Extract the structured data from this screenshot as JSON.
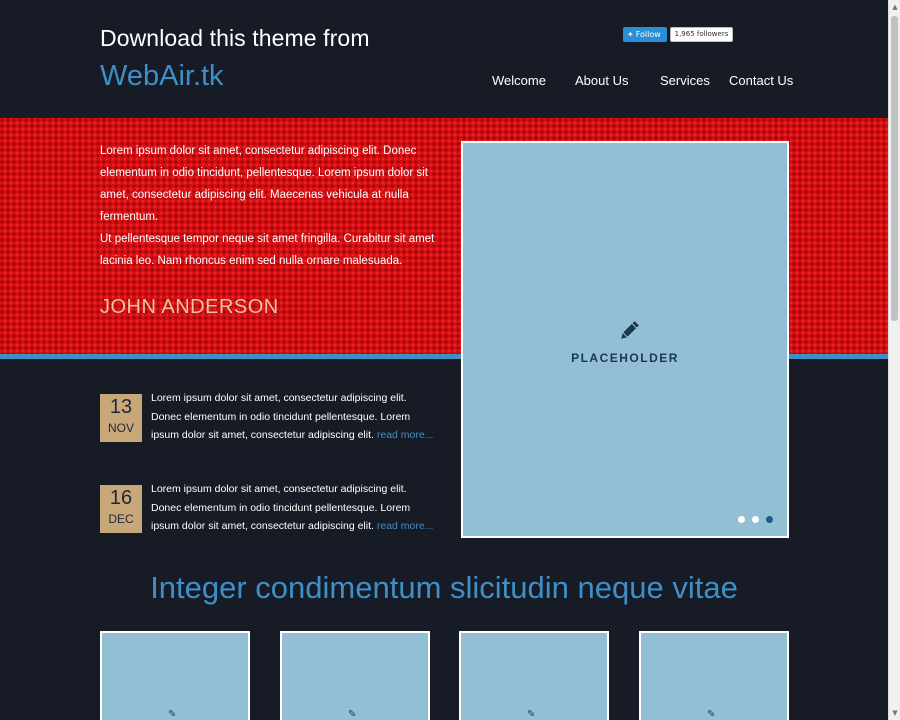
{
  "header": {
    "logo_line1": "Download this theme from",
    "logo_line2": "WebAir.tk",
    "twitter_follow": "Follow",
    "followers": "1,965 followers",
    "nav": [
      "Welcome",
      "About Us",
      "Services",
      "Contact Us"
    ]
  },
  "hero": {
    "paragraph1": "Lorem ipsum dolor sit amet, consectetur adipiscing elit. Donec elementum in odio tincidunt, pellentesque. Lorem ipsum dolor sit amet, consectetur adipiscing elit. Maecenas vehicula at nulla fermentum.",
    "paragraph2": "Ut pellentesque tempor neque sit amet fringilla. Curabitur sit amet lacinia leo. Nam rhoncus enim sed nulla ornare malesuada.",
    "author": "JOHN ANDERSON"
  },
  "slider": {
    "placeholder": "PLACEHOLDER",
    "icon": "pencil-icon",
    "slide_count": 3,
    "active_slide": 3
  },
  "news": [
    {
      "day": "13",
      "month": "NOV",
      "text": "Lorem ipsum dolor sit amet, consectetur adipiscing elit. Donec elementum in odio tincidunt pellentesque. Lorem ipsum dolor sit amet, consectetur adipiscing elit.",
      "read_more": "read more..."
    },
    {
      "day": "16",
      "month": "DEC",
      "text": "Lorem ipsum dolor sit amet, consectetur adipiscing elit. Donec elementum in odio tincidunt pellentesque. Lorem ipsum dolor sit amet, consectetur adipiscing elit.",
      "read_more": "read more..."
    }
  ],
  "section_heading": "Integer condimentum slicitudin neque vitae",
  "colors": {
    "background": "#161b25",
    "accent": "#3f8fc7",
    "hero_red": "#d80f12",
    "placeholder_blue": "#93bfd5",
    "date_tan": "#c8a779",
    "author_tan": "#e9c3a6"
  }
}
